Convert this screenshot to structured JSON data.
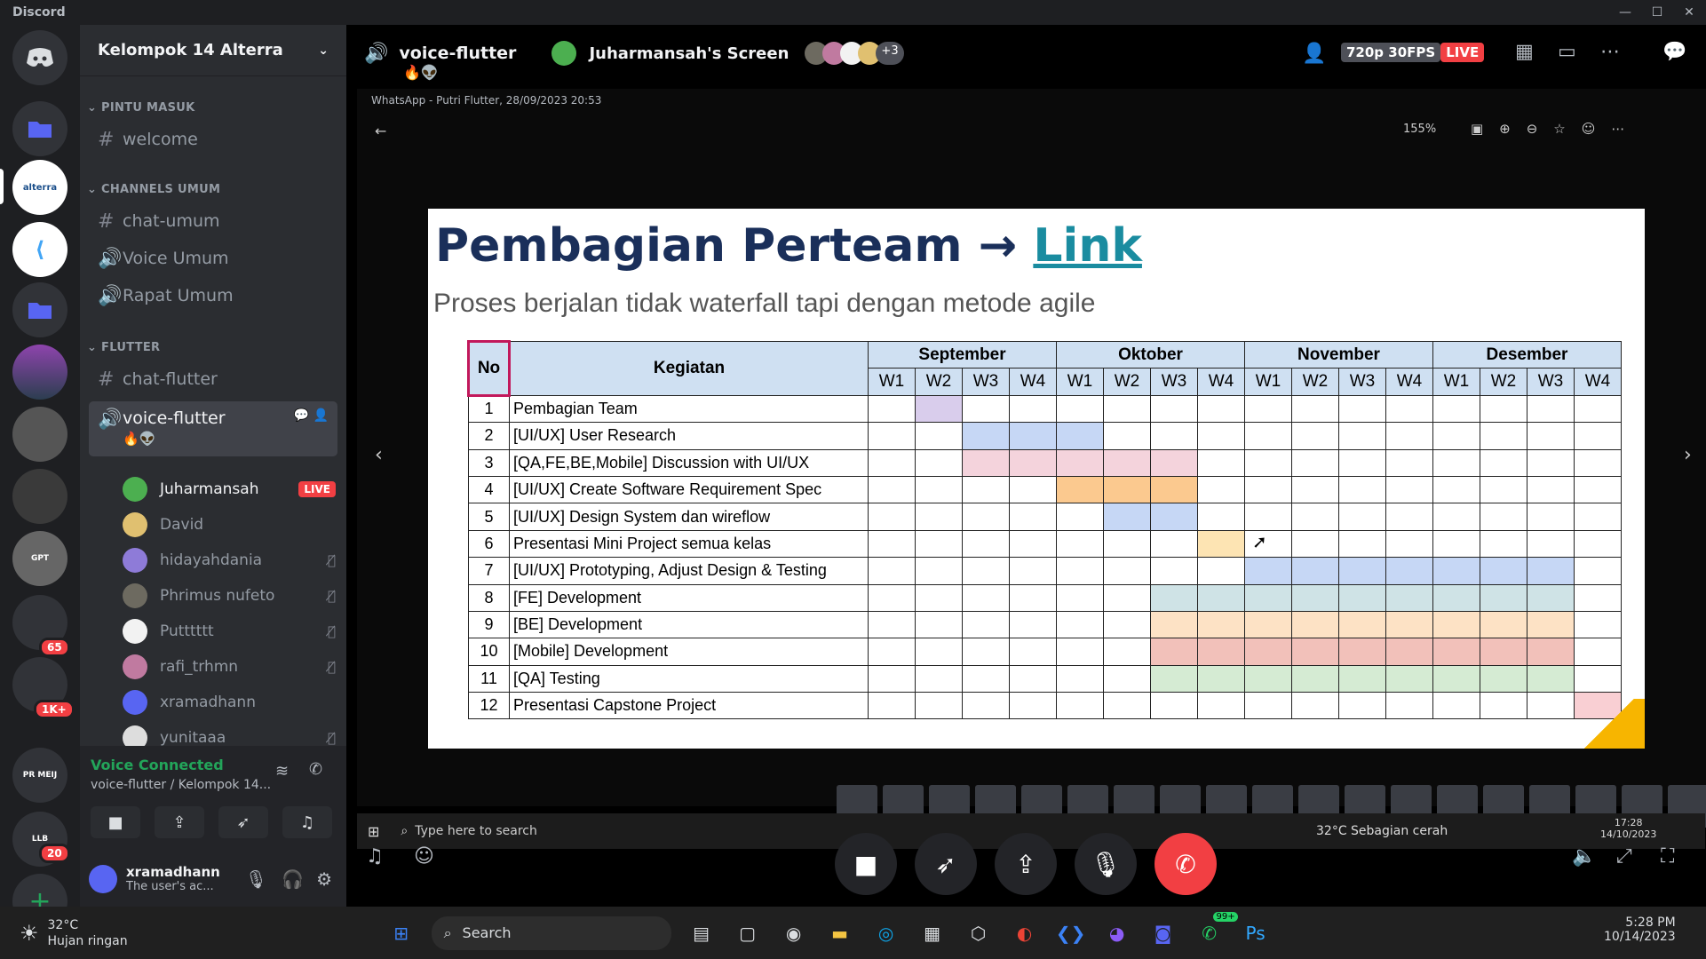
{
  "app": {
    "name": "Discord"
  },
  "server": {
    "name": "Kelompok 14 Alterra"
  },
  "categories": {
    "pintu_masuk": "PINTU MASUK",
    "channels_umum": "CHANNELS UMUM",
    "flutter": "FLUTTER"
  },
  "channels": {
    "welcome": "welcome",
    "chat_umum": "chat-umum",
    "voice_umum": "Voice Umum",
    "rapat_umum": "Rapat Umum",
    "chat_flutter": "chat-flutter",
    "voice_flutter": "voice-flutter",
    "voice_flutter_emoji": "🔥👽"
  },
  "members": [
    {
      "name": "Juharmansah",
      "live": "LIVE",
      "color": "#4caf50"
    },
    {
      "name": "David",
      "color": "#e0c070"
    },
    {
      "name": "hidayahdania",
      "color": "#8e7bd8"
    },
    {
      "name": "Phrimus nufeto",
      "color": "#6d6a60"
    },
    {
      "name": "Putttttt",
      "color": "#f2f2f2"
    },
    {
      "name": "rafi_trhmn",
      "color": "#c07aa0"
    },
    {
      "name": "xramadhann",
      "color": "#5865f2"
    },
    {
      "name": "yunitaaa",
      "color": "#dddddd"
    }
  ],
  "guild_badges": {
    "b1": "65",
    "b2": "1K+",
    "b3": "20"
  },
  "voice": {
    "status": "Voice Connected",
    "location": "voice-flutter / Kelompok 14..."
  },
  "user": {
    "name": "xramadhann",
    "status": "The user's ac..."
  },
  "header": {
    "channel": "voice-flutter",
    "screen": "Juharmansah's Screen",
    "extra": "+3",
    "quality": "720p 30FPS",
    "live": "LIVE"
  },
  "viewer": {
    "title": "WhatsApp - Putri Flutter, 28/09/2023 20:53",
    "zoom": "155%"
  },
  "slide": {
    "title": "Pembagian Perteam",
    "arrow": "→",
    "link": "Link",
    "subtitle": "Proses berjalan tidak waterfall tapi dengan metode agile",
    "col_no": "No",
    "col_task": "Kegiatan",
    "months": [
      "September",
      "Oktober",
      "November",
      "Desember"
    ],
    "weeks": [
      "W1",
      "W2",
      "W3",
      "W4"
    ],
    "rows": [
      {
        "no": "1",
        "task": "Pembagian Team",
        "start": 1,
        "end": 1,
        "color": "#d9cdec"
      },
      {
        "no": "2",
        "task": "[UI/UX] User Research",
        "start": 2,
        "end": 4,
        "color": "#c6d7f5"
      },
      {
        "no": "3",
        "task": "[QA,FE,BE,Mobile] Discussion with UI/UX",
        "start": 2,
        "end": 6,
        "color": "#f4d3dc"
      },
      {
        "no": "4",
        "task": "[UI/UX] Create Software Requirement Spec",
        "start": 4,
        "end": 6,
        "color": "#fbc98f"
      },
      {
        "no": "5",
        "task": "[UI/UX] Design System dan wireflow",
        "start": 5,
        "end": 6,
        "color": "#c6d7f5"
      },
      {
        "no": "6",
        "task": "Presentasi Mini Project semua kelas",
        "start": 7,
        "end": 7,
        "color": "#fde4b3"
      },
      {
        "no": "7",
        "task": "[UI/UX] Prototyping, Adjust Design & Testing",
        "start": 8,
        "end": 14,
        "color": "#c6d7f5"
      },
      {
        "no": "8",
        "task": "[FE] Development",
        "start": 6,
        "end": 14,
        "color": "#cfe3e6"
      },
      {
        "no": "9",
        "task": "[BE] Development",
        "start": 6,
        "end": 14,
        "color": "#fde2c5"
      },
      {
        "no": "10",
        "task": "[Mobile] Development",
        "start": 6,
        "end": 14,
        "color": "#f2c1ba"
      },
      {
        "no": "11",
        "task": "[QA] Testing",
        "start": 6,
        "end": 14,
        "color": "#d5ebd3"
      },
      {
        "no": "12",
        "task": "Presentasi Capstone Project",
        "start": 15,
        "end": 15,
        "color": "#f9cfd3"
      }
    ]
  },
  "inner_taskbar": {
    "search": "Type here to search",
    "weather": "32°C  Sebagian cerah",
    "time": "17:28",
    "date": "14/10/2023"
  },
  "taskbar": {
    "weather_temp": "32°C",
    "weather_desc": "Hujan ringan",
    "search": "Search",
    "time": "5:28 PM",
    "date": "10/14/2023",
    "whatsapp_badge": "99+"
  }
}
